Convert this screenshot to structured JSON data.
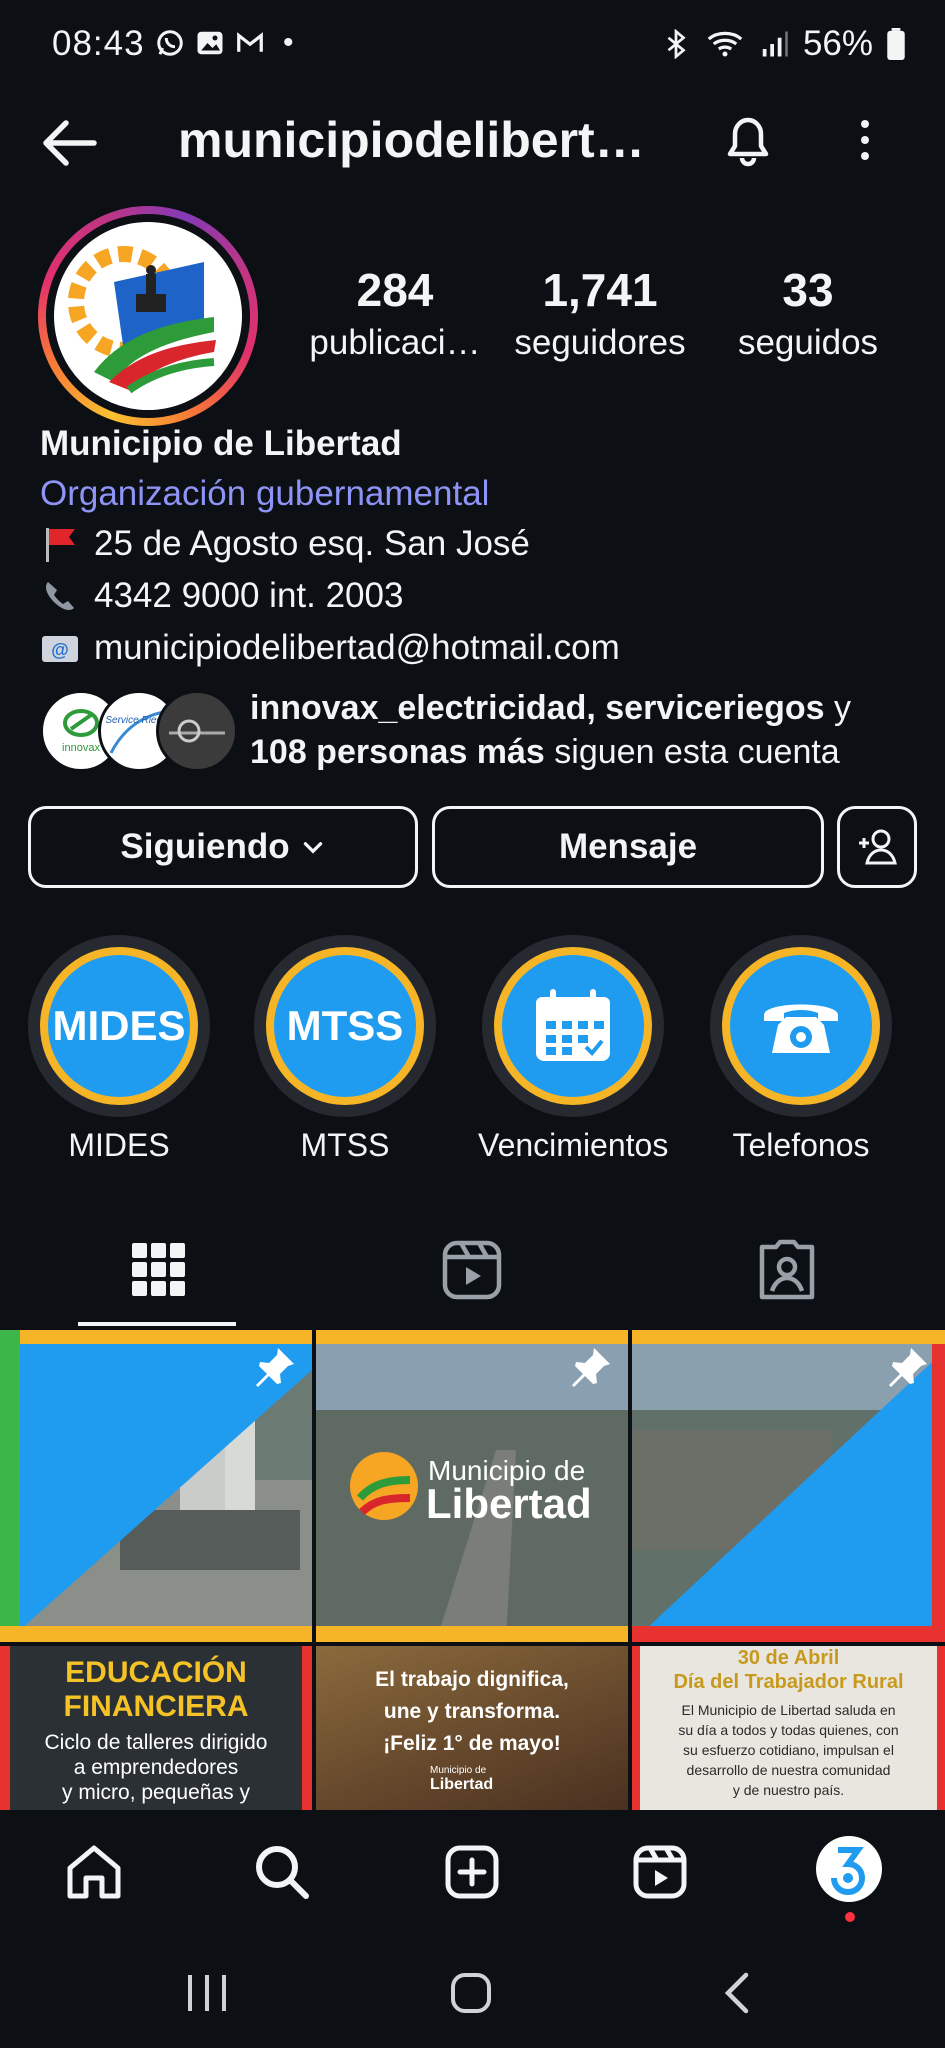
{
  "status_bar": {
    "time": "08:43",
    "battery": "56%",
    "dot": "•",
    "left_icons": [
      "whatsapp-icon",
      "gallery-icon",
      "gmail-icon"
    ],
    "right_icons": [
      "bluetooth-icon",
      "wifi-icon",
      "signal-icon",
      "battery-icon"
    ]
  },
  "header": {
    "title": "municipiodelibert…",
    "icons": [
      "back-arrow-icon",
      "bell-icon",
      "more-vertical-icon"
    ]
  },
  "profile": {
    "stats": [
      {
        "value": "284",
        "label": "publicaci…"
      },
      {
        "value": "1,741",
        "label": "seguidores"
      },
      {
        "value": "33",
        "label": "seguidos"
      }
    ],
    "name": "Municipio de Libertad",
    "category": "Organización gubernamental",
    "address": "25 de Agosto esq. San José",
    "phone": "4342 9000 int. 2003",
    "email": "municipiodelibertad@hotmail.com",
    "followed_by": {
      "names": "innovax_electricidad, serviceriegos",
      "connector": " y ",
      "more": "108 personas más",
      "suffix": " siguen esta cuenta",
      "avatar_labels": [
        "innovax",
        "Service Riegos"
      ]
    }
  },
  "actions": {
    "following_label": "Siguiendo",
    "message_label": "Mensaje"
  },
  "highlights": [
    {
      "label": "MIDES",
      "cover_text": "MIDES"
    },
    {
      "label": "MTSS",
      "cover_text": "MTSS"
    },
    {
      "label": "Vencimientos",
      "cover_icon": "calendar-icon"
    },
    {
      "label": "Telefonos",
      "cover_icon": "telephone-icon"
    }
  ],
  "tabs": [
    "grid-icon",
    "reels-icon",
    "tagged-icon"
  ],
  "posts": {
    "pinned_logo_line1": "Municipio de",
    "pinned_logo_line2": "Libertad",
    "post4_title1": "EDUCACIÓN",
    "post4_title2": "FINANCIERA",
    "post4_body1": "Ciclo de talleres dirigido",
    "post4_body2": "a emprendedores",
    "post4_body3": "y micro, pequeñas y",
    "post5_line1": "El trabajo dignifica,",
    "post5_line2": "une y transforma.",
    "post5_line3": "¡Feliz 1° de mayo!",
    "post5_logo1": "Municipio de",
    "post5_logo2": "Libertad",
    "post6_date": "30 de Abril",
    "post6_title": "Día del Trabajador Rural",
    "post6_body": [
      "El Municipio de Libertad saluda en",
      "su día a todos y todas quienes, con",
      "su esfuerzo cotidiano, impulsan el",
      "desarrollo de nuestra comunidad",
      "y de nuestro país."
    ]
  },
  "bottom_nav": [
    "home-icon",
    "search-icon",
    "create-icon",
    "reels-icon",
    "profile-avatar"
  ],
  "colors": {
    "background": "#0c0f14",
    "category": "#8e94f5",
    "highlight_blue": "#1f9cf0",
    "highlight_gold": "#f6b526",
    "notification_dot": "#ff3040"
  }
}
